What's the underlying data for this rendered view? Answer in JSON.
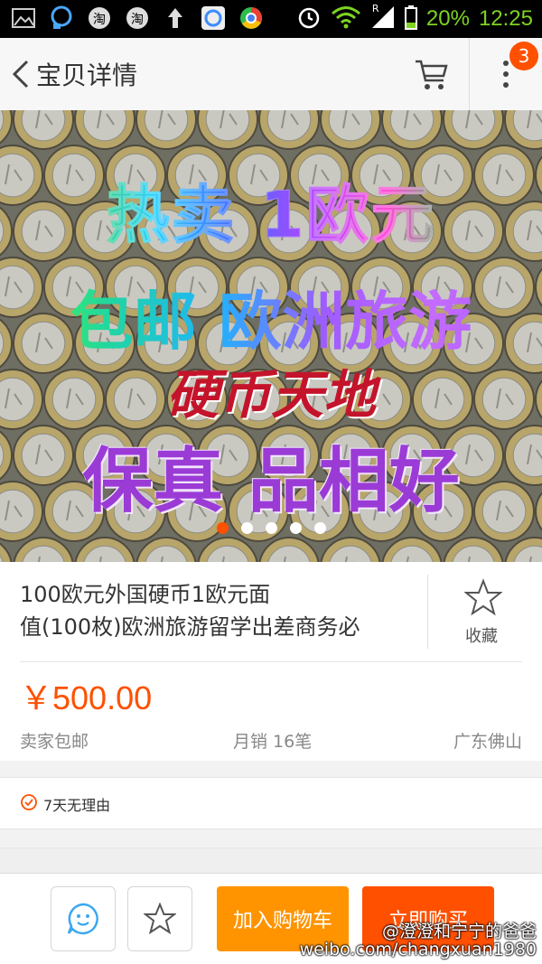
{
  "status_bar": {
    "battery_percent": "20%",
    "time": "12:25",
    "roaming_indicator": "R",
    "icons": [
      "image-icon",
      "qq-icon",
      "taobao-icon",
      "taobao-icon",
      "upload-arrow-icon",
      "browser-icon",
      "chrome-icon",
      "alarm-icon",
      "wifi-icon",
      "signal-icon",
      "battery-icon"
    ]
  },
  "header": {
    "title": "宝贝详情",
    "cart_badge": "3"
  },
  "hero": {
    "line1": "热卖 1欧元",
    "line2": "包邮 欧洲旅游",
    "line3": "硬币天地",
    "line4": "保真 品相好",
    "slide_count": 5,
    "active_slide": 1
  },
  "product": {
    "title_line1": "100欧元外国硬币1欧元面",
    "title_line2": "值(100枚)欧洲旅游留学出差商务必",
    "favorite_label": "收藏",
    "price": "￥500.00",
    "shipping": "卖家包邮",
    "monthly_sales": "月销 16笔",
    "location": "广东佛山"
  },
  "guarantee": {
    "text": "7天无理由"
  },
  "bottom_bar": {
    "add_to_cart": "加入购物车",
    "buy_now": "立即购买"
  },
  "watermark": {
    "line1": "@澄澄和宁宁的爸爸",
    "line2": "weibo.com/changxuan1980"
  },
  "colors": {
    "accent": "#ff5000",
    "cart_button": "#ff9400",
    "status_green": "#7ed321"
  }
}
